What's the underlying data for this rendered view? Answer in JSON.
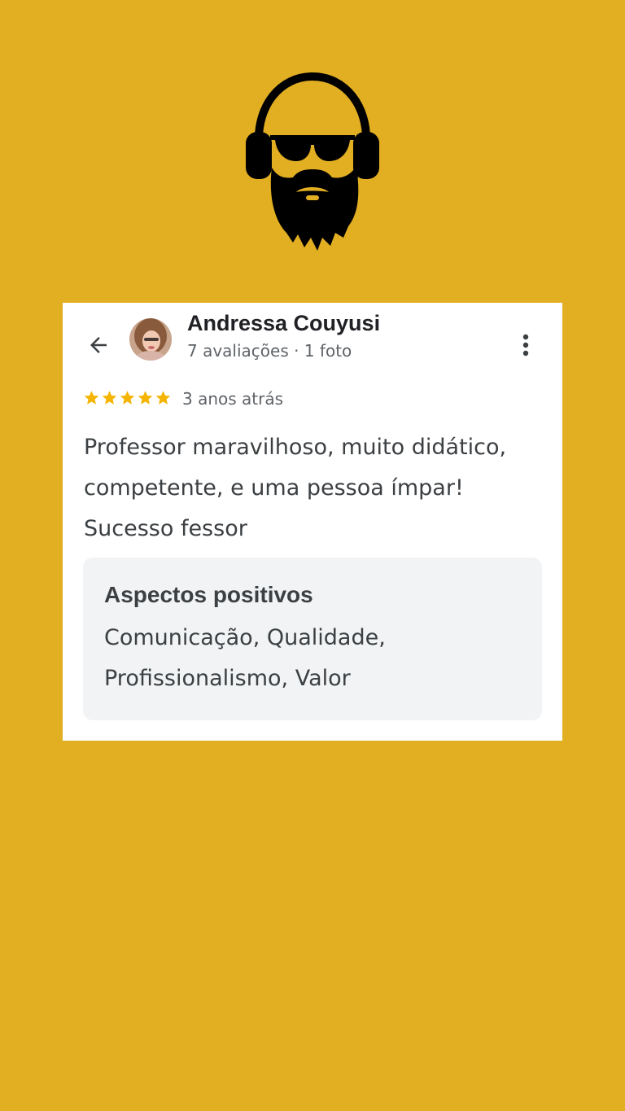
{
  "logo": {
    "icon": "bearded-man-with-headphones-and-sunglasses-logo"
  },
  "review": {
    "reviewer_name": "Andressa Couyusi",
    "reviewer_meta": "7 avaliações · 1 foto",
    "rating": 5,
    "rating_max": 5,
    "date": "3 anos atrás",
    "text": "Professor maravilhoso, muito didático, competente, e uma pessoa ímpar! Sucesso fessor",
    "aspects_title": "Aspectos positivos",
    "aspects_text": "Comunicação, Qualidade, Profissionalismo, Valor"
  },
  "icons": {
    "back": "arrow-back-icon",
    "more": "more-vert-icon",
    "star": "star-icon"
  },
  "colors": {
    "background": "#E2AE22",
    "card": "#FFFFFF",
    "star": "#F5B400",
    "aspects_bg": "#F1F3F4",
    "primary_text": "#202124",
    "secondary_text": "#5F6368",
    "body_text": "#3C4043"
  }
}
